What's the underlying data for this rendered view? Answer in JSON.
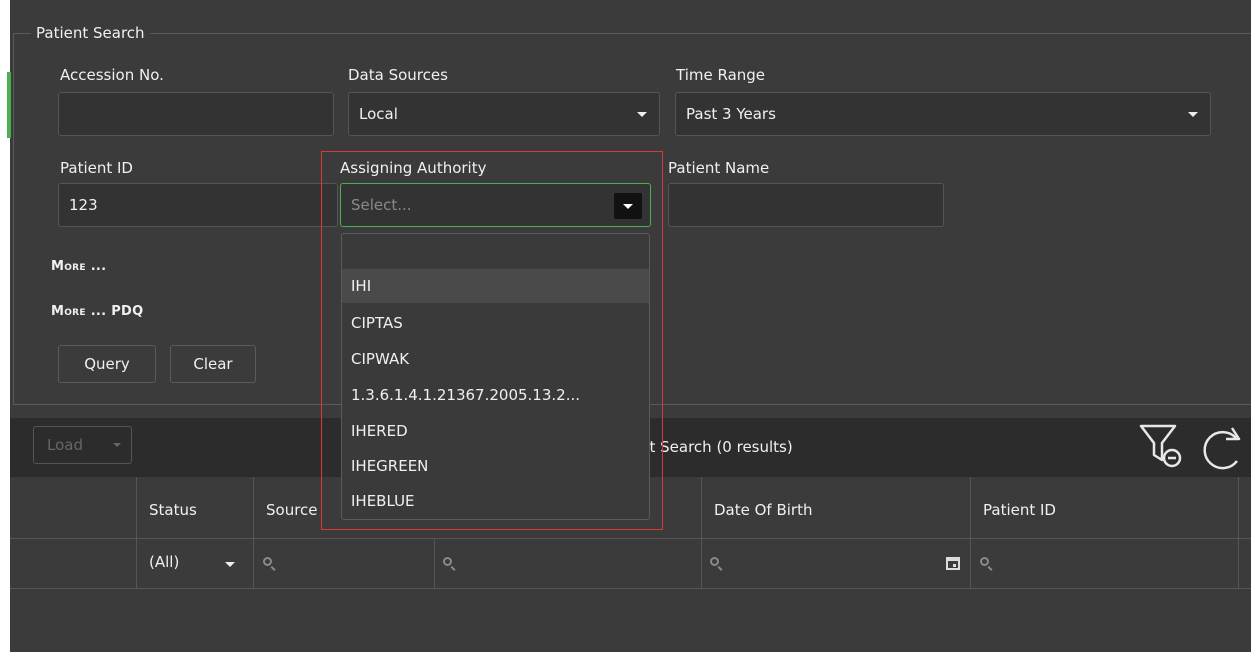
{
  "search": {
    "legend": "Patient Search",
    "accession": {
      "label": "Accession No.",
      "value": ""
    },
    "data_sources": {
      "label": "Data Sources",
      "value": "Local"
    },
    "time_range": {
      "label": "Time Range",
      "value": "Past 3 Years"
    },
    "patient_id": {
      "label": "Patient ID",
      "value": "123"
    },
    "assigning_authority": {
      "label": "Assigning Authority",
      "placeholder": "Select...",
      "options": [
        "",
        "IHI",
        "CIPTAS",
        "CIPWAK",
        "1.3.6.1.4.1.21367.2005.13.2...",
        "IHERED",
        "IHEGREEN",
        "IHEBLUE"
      ],
      "hovered_option": "IHI"
    },
    "patient_name": {
      "label": "Patient Name",
      "value": ""
    },
    "more": "More ...",
    "more_pdq": "More ... PDQ",
    "query_button": "Query",
    "clear_button": "Clear"
  },
  "toolbar": {
    "load_button": "Load",
    "grid_title_visible": "nt Search (0 results)"
  },
  "grid": {
    "columns": [
      "Status",
      "Source",
      "Date Of Birth",
      "Patient ID"
    ],
    "status_filter": "(All)"
  },
  "colors": {
    "accent_green": "#4caf50",
    "highlight_red": "#d83a3a"
  }
}
